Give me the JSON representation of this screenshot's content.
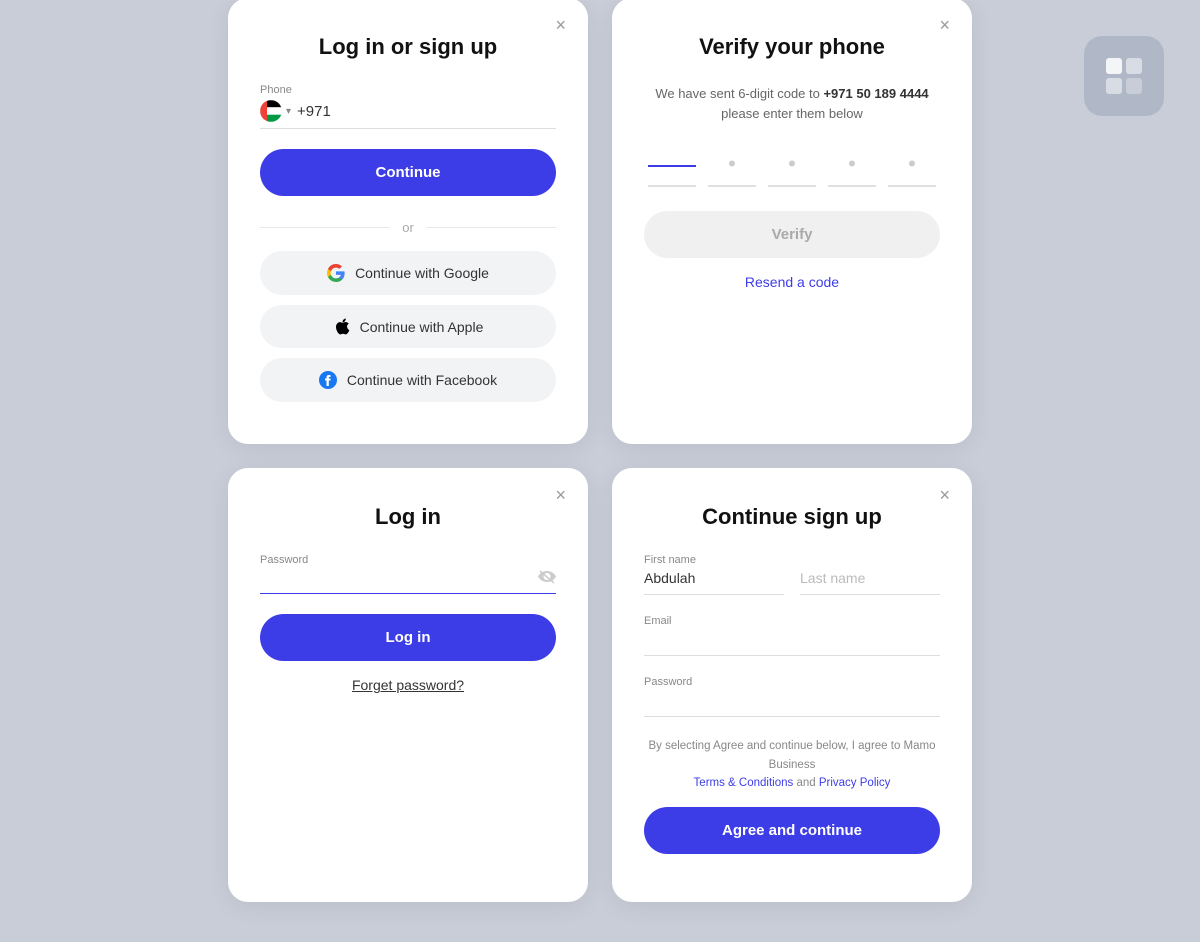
{
  "app_icon": {
    "aria": "app-icon"
  },
  "cards": {
    "login_signup": {
      "title": "Log in or sign up",
      "close": "×",
      "phone_label": "Phone",
      "phone_value": "+971",
      "continue_label": "Continue",
      "or_text": "or",
      "google_label": "Continue with Google",
      "apple_label": "Continue with Apple",
      "facebook_label": "Continue with Facebook"
    },
    "verify": {
      "title": "Verify your phone",
      "subtitle_prefix": "We have sent 6-digit code to ",
      "phone_number": "+971 50 189 4444",
      "subtitle_suffix": "please enter them below",
      "otp_dots": [
        "•",
        "•",
        "•",
        "•",
        "•"
      ],
      "verify_label": "Verify",
      "resend_label": "Resend a code",
      "close": "×"
    },
    "login": {
      "title": "Log in",
      "close": "×",
      "password_label": "Password",
      "password_placeholder": "",
      "login_label": "Log in",
      "forget_label": "Forget password?"
    },
    "continue_signup": {
      "title": "Continue sign up",
      "close": "×",
      "first_name_label": "First name",
      "first_name_value": "Abdulah",
      "last_name_placeholder": "Last name",
      "email_label": "Email",
      "email_placeholder": "",
      "password_label": "Password",
      "password_placeholder": "",
      "terms_prefix": "By selecting Agree and continue below, I agree to Mamo Business",
      "terms_link": "Terms & Conditions",
      "terms_and": "and",
      "privacy_link": "Privacy Policy",
      "agree_label": "Agree and continue"
    }
  }
}
